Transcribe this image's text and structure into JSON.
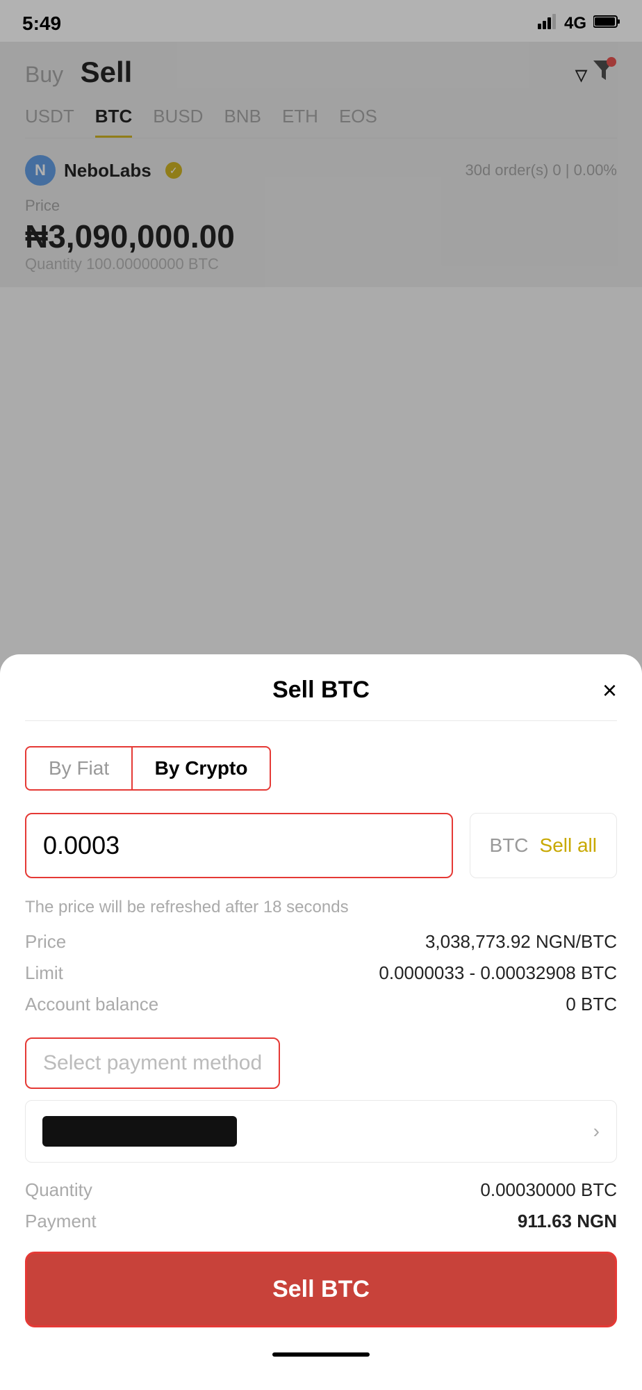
{
  "statusBar": {
    "time": "5:49",
    "signal": "4G",
    "battery": "full"
  },
  "background": {
    "buyLabel": "Buy",
    "sellLabel": "Sell",
    "coinTabs": [
      "USDT",
      "BTC",
      "BUSD",
      "BNB",
      "ETH",
      "EOS"
    ],
    "activeCoinTab": "BTC",
    "merchant": {
      "initial": "N",
      "name": "NeboLabs",
      "verified": true,
      "orders30d": "30d order(s) 0",
      "rate": "0.00%"
    },
    "priceLabel": "Price",
    "priceValue": "₦3,090,000.00",
    "quantityLabel": "Quantity",
    "quantityValue": "100.00000000 BTC"
  },
  "modal": {
    "title": "Sell BTC",
    "closeLabel": "×",
    "paymentTypeTabs": [
      "By Fiat",
      "By Crypto"
    ],
    "activePaymentType": "By Crypto",
    "amountInput": {
      "value": "0.0003",
      "currency": "BTC",
      "sellAllLabel": "Sell all"
    },
    "refreshNotice": "The price will be refreshed after 18 seconds",
    "infoRows": [
      {
        "label": "Price",
        "value": "3,038,773.92 NGN/BTC"
      },
      {
        "label": "Limit",
        "value": "0.0000033 - 0.00032908 BTC"
      },
      {
        "label": "Account balance",
        "value": "0 BTC"
      }
    ],
    "paymentMethodLabel": "Select payment method",
    "summaryRows": [
      {
        "label": "Quantity",
        "value": "0.00030000 BTC"
      },
      {
        "label": "Payment",
        "value": "911.63 NGN"
      }
    ],
    "sellButtonLabel": "Sell BTC"
  }
}
